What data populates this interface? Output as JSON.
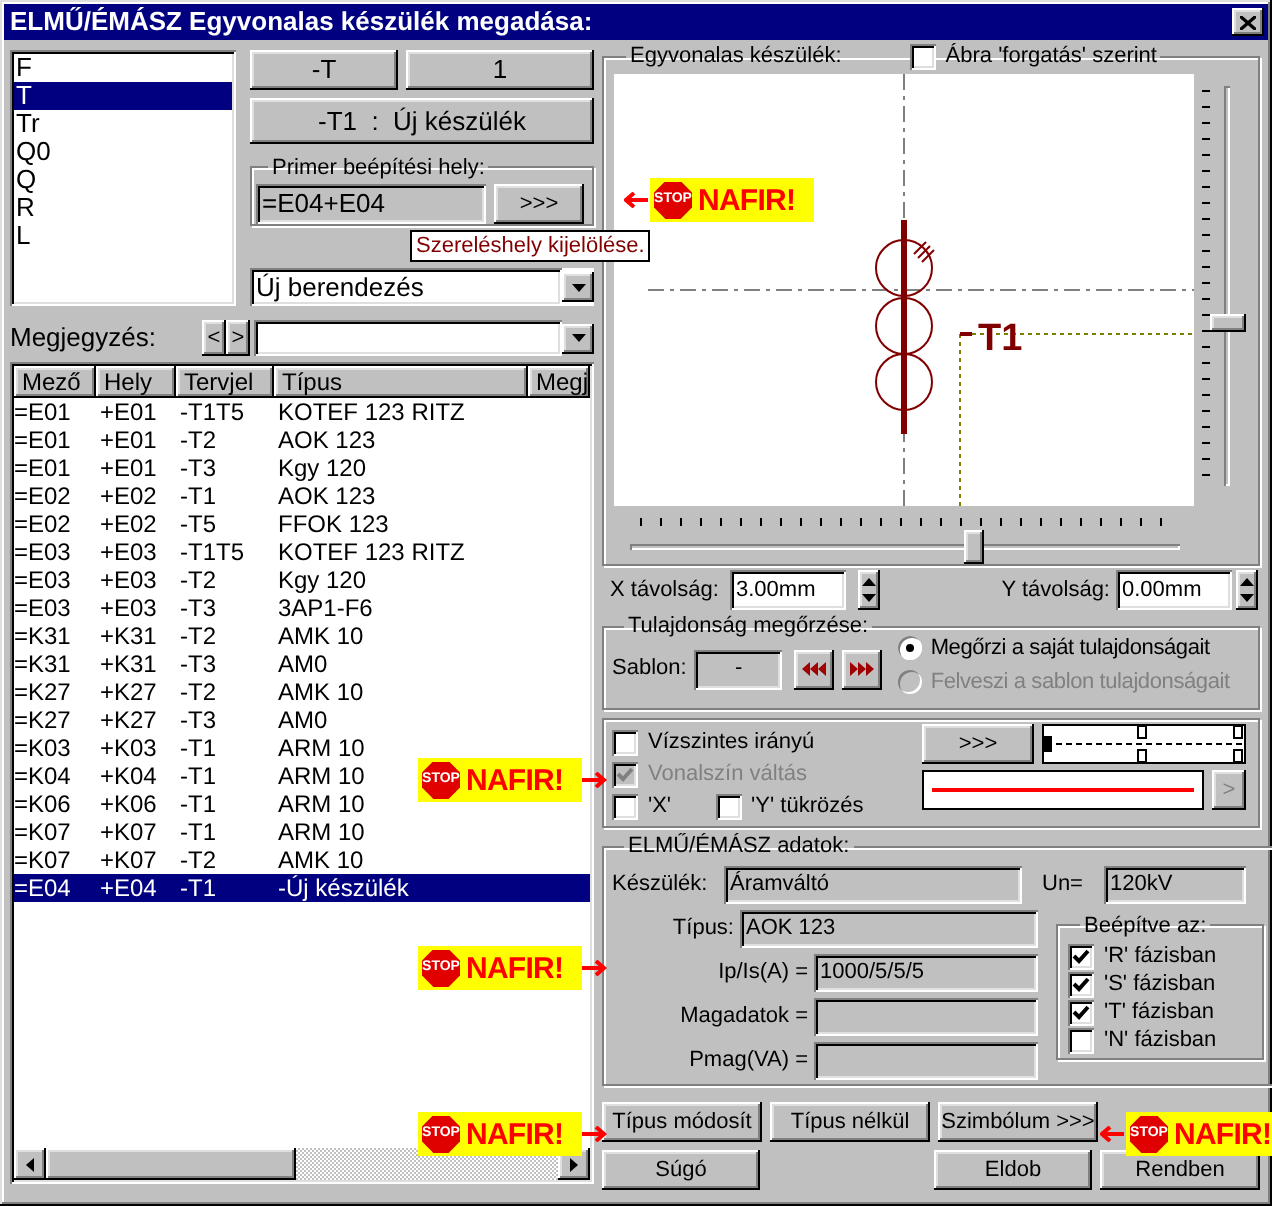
{
  "window": {
    "title": "ELMŰ/ÉMÁSZ Egyvonalas készülék megadása:"
  },
  "prefix_list": [
    {
      "label": "F",
      "selected": false
    },
    {
      "label": "T",
      "selected": true
    },
    {
      "label": "Tr",
      "selected": false
    },
    {
      "label": "Q0",
      "selected": false
    },
    {
      "label": "Q",
      "selected": false
    },
    {
      "label": "R",
      "selected": false
    },
    {
      "label": "L",
      "selected": false
    }
  ],
  "prefix_button": "-T",
  "number_button": "1",
  "device_button": "-T1  :  Új készülék",
  "primer": {
    "title": "Primer beépítési hely:",
    "value": "=E04+E04",
    "button": ">>>",
    "tooltip": "Szereléshely kijelölése."
  },
  "device_select": {
    "value": "Új berendezés"
  },
  "remark": {
    "label": "Megjegyzés:",
    "prev": "<",
    "next": ">"
  },
  "table": {
    "columns": [
      "Mező",
      "Hely",
      "Tervjel",
      "Típus",
      "Megj"
    ],
    "rows": [
      {
        "cells": [
          "=E01",
          "+E01",
          "-T1T5",
          "KOTEF 123 RITZ"
        ],
        "selected": false
      },
      {
        "cells": [
          "=E01",
          "+E01",
          "-T2",
          "AOK 123"
        ],
        "selected": false
      },
      {
        "cells": [
          "=E01",
          "+E01",
          "-T3",
          "Kgy 120"
        ],
        "selected": false
      },
      {
        "cells": [
          "=E02",
          "+E02",
          "-T1",
          "AOK 123"
        ],
        "selected": false
      },
      {
        "cells": [
          "=E02",
          "+E02",
          "-T5",
          "FFOK 123"
        ],
        "selected": false
      },
      {
        "cells": [
          "=E03",
          "+E03",
          "-T1T5",
          "KOTEF 123 RITZ"
        ],
        "selected": false
      },
      {
        "cells": [
          "=E03",
          "+E03",
          "-T2",
          "Kgy 120"
        ],
        "selected": false
      },
      {
        "cells": [
          "=E03",
          "+E03",
          "-T3",
          "3AP1-F6"
        ],
        "selected": false
      },
      {
        "cells": [
          "=K31",
          "+K31",
          "-T2",
          "AMK 10"
        ],
        "selected": false
      },
      {
        "cells": [
          "=K31",
          "+K31",
          "-T3",
          "AM0"
        ],
        "selected": false
      },
      {
        "cells": [
          "=K27",
          "+K27",
          "-T2",
          "AMK 10"
        ],
        "selected": false
      },
      {
        "cells": [
          "=K27",
          "+K27",
          "-T3",
          "AM0"
        ],
        "selected": false
      },
      {
        "cells": [
          "=K03",
          "+K03",
          "-T1",
          "ARM 10"
        ],
        "selected": false
      },
      {
        "cells": [
          "=K04",
          "+K04",
          "-T1",
          "ARM 10"
        ],
        "selected": false
      },
      {
        "cells": [
          "=K06",
          "+K06",
          "-T1",
          "ARM 10"
        ],
        "selected": false
      },
      {
        "cells": [
          "=K07",
          "+K07",
          "-T1",
          "ARM 10"
        ],
        "selected": false
      },
      {
        "cells": [
          "=K07",
          "+K07",
          "-T2",
          "AMK 10"
        ],
        "selected": false
      },
      {
        "cells": [
          "=E04",
          "+E04",
          "-T1",
          "-Új készülék"
        ],
        "selected": true
      }
    ]
  },
  "symbol": {
    "title": "Egyvonalas készülék:",
    "rotate": {
      "label": "Ábra 'forgatás' szerint",
      "checked": false
    },
    "label": "T1",
    "vertical_slider": {
      "level": 0.4
    },
    "horizontal_slider": {
      "level": 0.63
    }
  },
  "x_distance": {
    "label": "X távolság:",
    "value": "3.00mm"
  },
  "y_distance": {
    "label": "Y távolság:",
    "value": "0.00mm"
  },
  "keep": {
    "title": "Tulajdonság megőrzése:",
    "template_label": "Sablon:",
    "template_value": "-",
    "options": [
      {
        "label": "Megőrzi a saját tulajdonságait",
        "selected": true,
        "disabled": false
      },
      {
        "label": "Felveszi a sablon tulajdonságait",
        "selected": false,
        "disabled": true
      }
    ]
  },
  "line_options": {
    "checkboxes": [
      {
        "label": "Vízszintes irányú",
        "checked": false,
        "disabled": false
      },
      {
        "label": "Vonalszín váltás",
        "checked": true,
        "disabled": true
      },
      {
        "label": "'X'",
        "checked": false,
        "disabled": false
      },
      {
        "label": "'Y' tükrözés",
        "checked": false,
        "disabled": false
      }
    ],
    "style_button": ">>>",
    "color_button": {
      "label": ">",
      "disabled": true
    }
  },
  "data": {
    "title": "ELMŰ/ÉMÁSZ adatok:",
    "device": {
      "label": "Készülék:",
      "value": "Áramváltó"
    },
    "un": {
      "label": "Un=",
      "value": "120kV"
    },
    "fields": [
      {
        "label": "Típus:",
        "value": "AOK 123"
      },
      {
        "label": "Ip/Is(A) =",
        "value": "1000/5/5/5"
      },
      {
        "label": "Magadatok ="
      },
      {
        "label": "Pmag(VA) ="
      }
    ],
    "phases": {
      "title": "Beépítve az:",
      "items": [
        {
          "label": "'R' fázisban",
          "checked": true
        },
        {
          "label": "'S' fázisban",
          "checked": true
        },
        {
          "label": "'T' fázisban",
          "checked": true
        },
        {
          "label": "'N' fázisban",
          "checked": false
        }
      ]
    }
  },
  "action_buttons": [
    "Típus módosít",
    "Típus nélkül",
    "Szimbólum >>>"
  ],
  "dialog_buttons": [
    "Súgó",
    "Eldob",
    "Rendben"
  ],
  "annotations": [
    {
      "kind": "arrow_left",
      "stop": "STOP",
      "text": "NAFIR!"
    },
    {
      "kind": "arrow_right",
      "stop": "STOP",
      "text": "NAFIR!"
    },
    {
      "kind": "arrow_right",
      "stop": "STOP",
      "text": "NAFIR!"
    },
    {
      "kind": "arrow_right",
      "stop": "STOP",
      "text": "NAFIR!"
    },
    {
      "kind": "arrow_left",
      "stop": "STOP",
      "text": "NAFIR!"
    }
  ]
}
